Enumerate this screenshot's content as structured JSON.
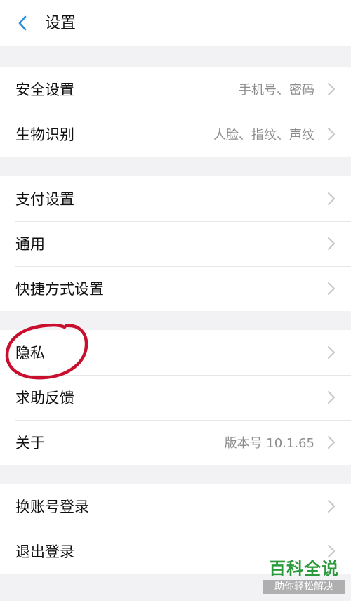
{
  "header": {
    "back_icon": "chevron-left-icon",
    "title": "设置"
  },
  "groups": [
    {
      "items": [
        {
          "label": "安全设置",
          "value": "手机号、密码"
        },
        {
          "label": "生物识别",
          "value": "人脸、指纹、声纹"
        }
      ]
    },
    {
      "items": [
        {
          "label": "支付设置",
          "value": ""
        },
        {
          "label": "通用",
          "value": ""
        },
        {
          "label": "快捷方式设置",
          "value": ""
        }
      ]
    },
    {
      "items": [
        {
          "label": "隐私",
          "value": ""
        },
        {
          "label": "求助反馈",
          "value": ""
        },
        {
          "label": "关于",
          "value": "版本号 10.1.65"
        }
      ]
    },
    {
      "items": [
        {
          "label": "换账号登录",
          "value": ""
        },
        {
          "label": "退出登录",
          "value": ""
        }
      ]
    }
  ],
  "watermark": {
    "title": "百科全说",
    "subtitle": "助你轻松解决"
  },
  "colors": {
    "accent": "#2a8ed8",
    "background": "#f2f2f4",
    "annotation": "#c8102e",
    "watermark": "#2a9a3c"
  }
}
